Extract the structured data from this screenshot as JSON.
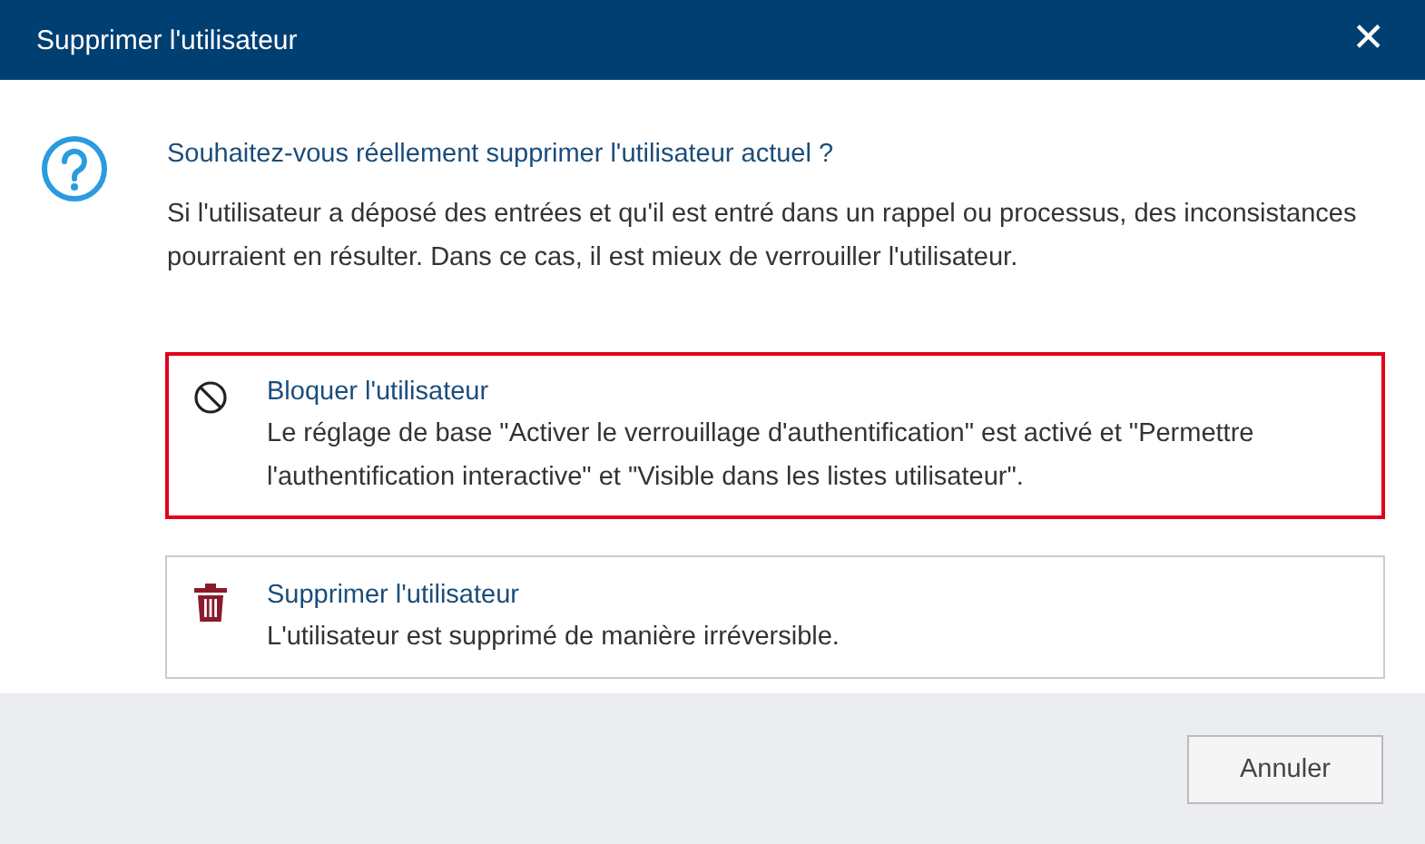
{
  "window": {
    "title": "Supprimer l'utilisateur",
    "close": "✕"
  },
  "question": {
    "heading": "Souhaitez-vous réellement supprimer l'utilisateur actuel ?",
    "text": "Si l'utilisateur a déposé des entrées et qu'il est entré dans un rappel ou processus, des inconsistances pourraient en résulter. Dans ce cas, il est mieux de verrouiller l'utilisateur."
  },
  "options": [
    {
      "kind": "block",
      "title": "Bloquer l'utilisateur",
      "description": "Le réglage de base \"Activer le verrouillage d'authentification\" est activé et \"Permettre l'authentification interactive\" et \"Visible dans les listes utilisateur\".",
      "selected": true
    },
    {
      "kind": "delete",
      "title": "Supprimer l'utilisateur",
      "description": "L'utilisateur est supprimé de manière irréversible.",
      "selected": false
    }
  ],
  "buttons": [
    "Annuler"
  ]
}
